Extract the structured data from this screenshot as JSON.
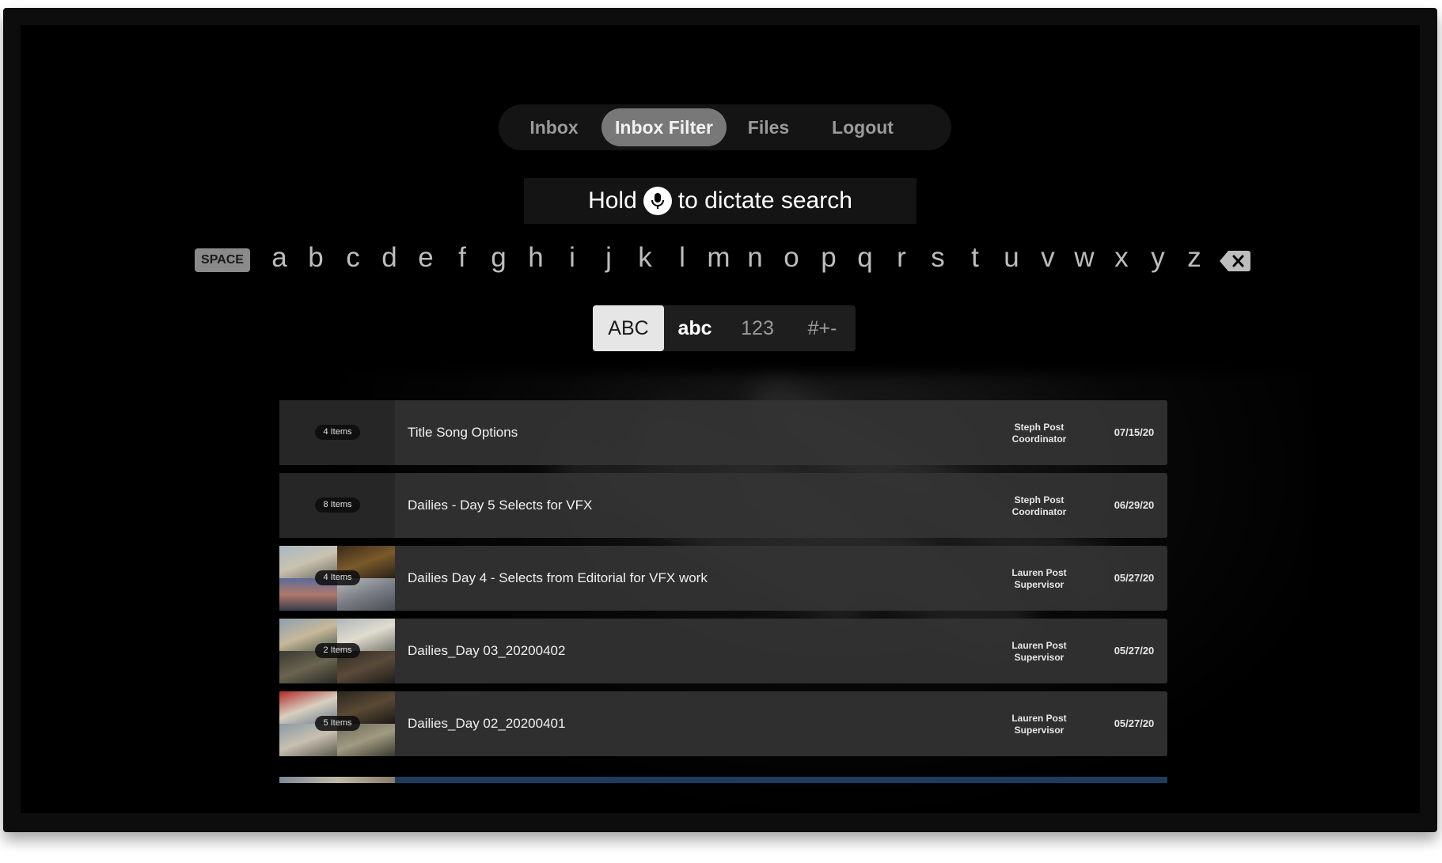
{
  "nav": {
    "tabs": [
      {
        "label": "Inbox",
        "active": false
      },
      {
        "label": "Inbox Filter",
        "active": true
      },
      {
        "label": "Files",
        "active": false
      },
      {
        "label": "Logout",
        "active": false
      }
    ]
  },
  "search": {
    "prefix": "Hold",
    "suffix": "to dictate search",
    "icon": "microphone-icon"
  },
  "keyboard": {
    "space_label": "SPACE",
    "letters": [
      "a",
      "b",
      "c",
      "d",
      "e",
      "f",
      "g",
      "h",
      "i",
      "j",
      "k",
      "l",
      "m",
      "n",
      "o",
      "p",
      "q",
      "r",
      "s",
      "t",
      "u",
      "v",
      "w",
      "x",
      "y",
      "z"
    ],
    "backspace_icon": "backspace-icon",
    "modes": [
      {
        "label": "ABC",
        "active": true
      },
      {
        "label": "abc",
        "active": false
      },
      {
        "label": "123",
        "active": false
      },
      {
        "label": "#+-",
        "active": false
      }
    ]
  },
  "list": {
    "rows": [
      {
        "badge": "4 Items",
        "title": "Title Song Options",
        "owner": "Steph Post",
        "role": "Coordinator",
        "date": "07/15/20",
        "thumb": "none"
      },
      {
        "badge": "8 Items",
        "title": "Dailies - Day 5 Selects for VFX",
        "owner": "Steph Post",
        "role": "Coordinator",
        "date": "06/29/20",
        "thumb": "none"
      },
      {
        "badge": "4 Items",
        "title": "Dailies Day 4 - Selects from Editorial for VFX work",
        "owner": "Lauren Post",
        "role": "Supervisor",
        "date": "05/27/20",
        "thumb": "collage"
      },
      {
        "badge": "2 Items",
        "title": "Dailies_Day 03_20200402",
        "owner": "Lauren Post",
        "role": "Supervisor",
        "date": "05/27/20",
        "thumb": "collage"
      },
      {
        "badge": "5 Items",
        "title": "Dailies_Day 02_20200401",
        "owner": "Lauren Post",
        "role": "Supervisor",
        "date": "05/27/20",
        "thumb": "collage"
      }
    ]
  },
  "colors": {
    "background": "#000000",
    "active_tab": "#787878",
    "row_bg": "#343434",
    "highlight_row": "#1e3d5e"
  }
}
